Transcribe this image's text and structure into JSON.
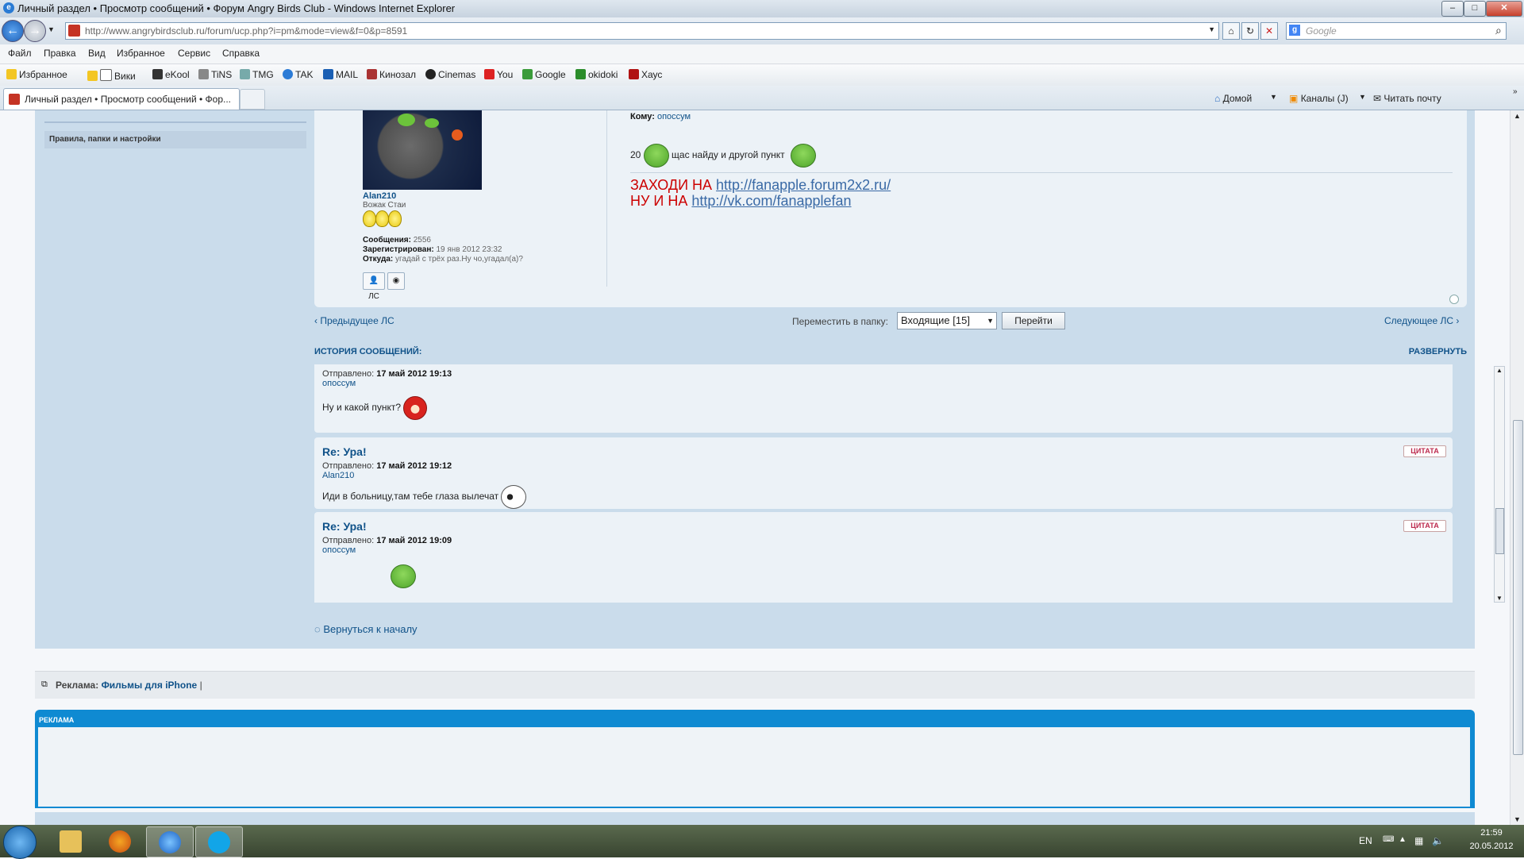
{
  "window": {
    "title": "Личный раздел • Просмотр сообщений • Форум Angry Birds Club - Windows Internet Explorer",
    "min": "–",
    "max": "□",
    "close": "✕"
  },
  "address": {
    "url": "http://www.angrybirdsclub.ru/forum/ucp.php?i=pm&mode=view&f=0&p=8591",
    "search_placeholder": "Google"
  },
  "menu": [
    "Файл",
    "Правка",
    "Вид",
    "Избранное",
    "Сервис",
    "Справка"
  ],
  "favorites": {
    "label": "Избранное",
    "links": [
      "Вики",
      "eKool",
      "TiNS",
      "TMG",
      "TAK",
      "MAIL",
      "Кинозал",
      "Cinemas",
      "You",
      "Google",
      "okidoki",
      "Хаус"
    ]
  },
  "tab": {
    "title": "Личный раздел • Просмотр сообщений • Фор..."
  },
  "commands": {
    "home": "Домой",
    "feeds": "Каналы (J)",
    "read_mail": "Читать почту"
  },
  "sidebar": {
    "section": "Правила, папки и настройки"
  },
  "post": {
    "author": "Alan210",
    "rank": "Вожак Стаи",
    "posts_label": "Сообщения:",
    "posts_value": "2556",
    "reg_label": "Зарегистрирован:",
    "reg_value": "19 янв 2012 23:32",
    "from_label": "Откуда:",
    "from_value": "угадай с трёх раз.Ну чо,угадал(а)?",
    "pm_button": "ЛС",
    "to_label": "Кому:",
    "to_value": "опоссум",
    "text_prefix": "20",
    "text": "щас найду и другой пункт",
    "sig_line1_text": "ЗАХОДИ НА",
    "sig_line1_link": "http://fanapple.forum2x2.ru/",
    "sig_line2_text": "НУ И НА",
    "sig_line2_link": "http://vk.com/fanapplefan"
  },
  "nav": {
    "prev": "‹ Предыдущее ЛС",
    "next": "Следующее ЛС ›",
    "move_label": "Переместить в папку:",
    "folder": "Входящие [15]",
    "go": "Перейти"
  },
  "history": {
    "title": "ИСТОРИЯ СООБЩЕНИЙ:",
    "expand": "РАЗВЕРНУТЬ",
    "sent_label": "Отправлено:",
    "quote": "ЦИТАТА",
    "messages": [
      {
        "subject": "",
        "sent": "17 май 2012 19:13",
        "author": "опоссум",
        "body": "Ну и какой пункт?"
      },
      {
        "subject": "Re: Ура!",
        "sent": "17 май 2012 19:12",
        "author": "Alan210",
        "body": "Иди в больницу,там тебе глаза вылечат"
      },
      {
        "subject": "Re: Ура!",
        "sent": "17 май 2012 19:09",
        "author": "опоссум",
        "body": ""
      }
    ]
  },
  "back_to_top": "Вернуться к началу",
  "ads": {
    "label": "Реклама:",
    "link": "Фильмы для iPhone",
    "sep": "|",
    "box_title": "РЕКЛАМА"
  },
  "taskbar": {
    "lang": "EN",
    "time": "21:59",
    "date": "20.05.2012"
  },
  "colors": {
    "accent": "#105289",
    "panel": "#cadceb",
    "ad_header": "#0f8ad2",
    "signature_red": "#cc0000"
  }
}
